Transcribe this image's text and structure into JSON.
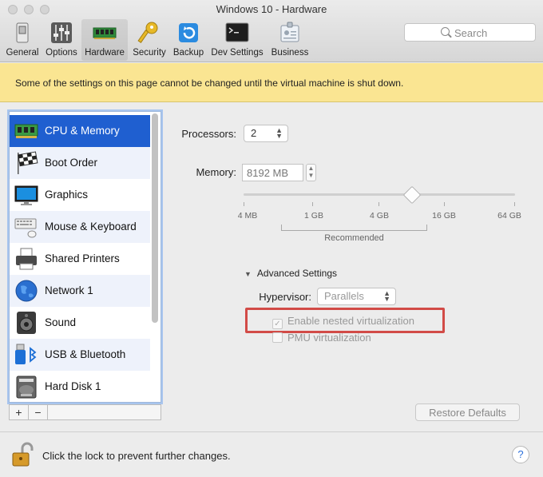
{
  "window": {
    "title": "Windows 10 - Hardware"
  },
  "toolbar": {
    "tabs": [
      {
        "label": "General",
        "icon": "switch-icon"
      },
      {
        "label": "Options",
        "icon": "sliders-icon"
      },
      {
        "label": "Hardware",
        "icon": "memory-chip-icon",
        "selected": true
      },
      {
        "label": "Security",
        "icon": "key-icon"
      },
      {
        "label": "Backup",
        "icon": "backup-icon"
      },
      {
        "label": "Dev Settings",
        "icon": "terminal-icon"
      },
      {
        "label": "Business",
        "icon": "id-badge-icon"
      }
    ],
    "search_placeholder": "Search"
  },
  "banner": {
    "text": "Some of the settings on this page cannot be changed until the virtual machine is shut down."
  },
  "sidebar": {
    "items": [
      {
        "label": "CPU & Memory",
        "icon": "cpu-memory-icon",
        "selected": true
      },
      {
        "label": "Boot Order",
        "icon": "checkered-flag-icon"
      },
      {
        "label": "Graphics",
        "icon": "monitor-icon"
      },
      {
        "label": "Mouse & Keyboard",
        "icon": "keyboard-mouse-icon"
      },
      {
        "label": "Shared Printers",
        "icon": "printer-icon"
      },
      {
        "label": "Network 1",
        "icon": "globe-icon"
      },
      {
        "label": "Sound",
        "icon": "speaker-icon"
      },
      {
        "label": "USB & Bluetooth",
        "icon": "usb-bluetooth-icon"
      },
      {
        "label": "Hard Disk 1",
        "icon": "hard-disk-icon"
      }
    ],
    "add_label": "+",
    "remove_label": "−"
  },
  "cpu": {
    "processors_label": "Processors:",
    "processors_value": "2",
    "memory_label": "Memory:",
    "memory_value": "8192 MB",
    "memory_slider_position": 0.62,
    "slider_ticks": [
      "4 MB",
      "1 GB",
      "4 GB",
      "16 GB",
      "64 GB"
    ],
    "recommended_label": "Recommended"
  },
  "advanced": {
    "heading": "Advanced Settings",
    "hypervisor_label": "Hypervisor:",
    "hypervisor_value": "Parallels",
    "nested_label": "Enable nested virtualization",
    "nested_checked": true,
    "pmu_label": "PMU virtualization",
    "pmu_checked": false,
    "highlight_color": "#d24b47"
  },
  "buttons": {
    "restore_defaults": "Restore Defaults"
  },
  "footer": {
    "lock_text": "Click the lock to prevent further changes.",
    "help_label": "?"
  },
  "colors": {
    "selection": "#1f5fd0",
    "banner": "#fae592"
  }
}
